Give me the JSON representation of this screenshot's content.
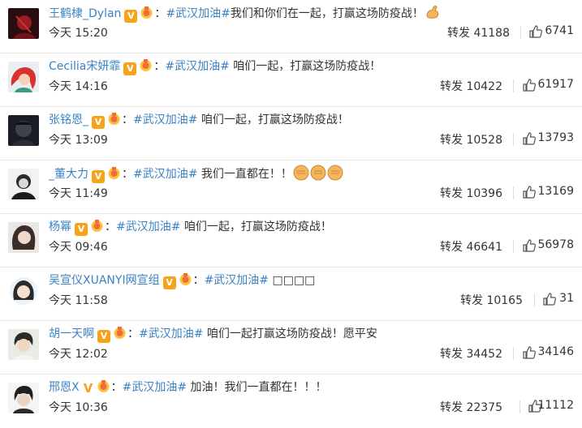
{
  "posts": [
    {
      "name": "王鹤棣_Dylan",
      "tag": "#武汉加油#",
      "text": "我们和你们在一起，打赢这场防疫战！",
      "time": "今天 15:20",
      "repost_label": "转发",
      "repost_count": "41188",
      "likes": "6741",
      "emoji": "flexed-arm-icon"
    },
    {
      "name": "Cecilia宋妍霏",
      "tag": "#武汉加油#",
      "text": " 咱们一起，打赢这场防疫战！",
      "time": "今天 14:16",
      "repost_label": "转发",
      "repost_count": "10422",
      "likes": "61917"
    },
    {
      "name": "张铭恩_",
      "tag": "#武汉加油#",
      "text": " 咱们一起，打赢这场防疫战！",
      "time": "今天 13:09",
      "repost_label": "转发",
      "repost_count": "10528",
      "likes": "13793"
    },
    {
      "name": "_董大力",
      "tag": "#武汉加油#",
      "text": " 我们一直都在！！",
      "time": "今天 11:49",
      "repost_label": "转发",
      "repost_count": "10396",
      "likes": "13169",
      "emoji": "fist-icon"
    },
    {
      "name": "杨幂",
      "tag": "#武汉加油#",
      "text": " 咱们一起，打赢这场防疫战！",
      "time": "今天 09:46",
      "repost_label": "转发",
      "repost_count": "46641",
      "likes": "56978"
    },
    {
      "name": "吴宣仪XUANYI网宣组",
      "tag": "#武汉加油#",
      "text": " □□□□",
      "time": "今天 11:58",
      "repost_label": "转发",
      "repost_count": "10165",
      "likes": "31"
    },
    {
      "name": "胡一天啊",
      "tag": "#武汉加油#",
      "text": " 咱们一起打赢这场防疫战！愿平安",
      "time": "今天 12:02",
      "repost_label": "转发",
      "repost_count": "34452",
      "likes": "34146"
    },
    {
      "name": "邢恩X",
      "tag": "#武汉加油#",
      "text": " 加油！我们一直都在！！！",
      "time": "今天 10:36",
      "repost_label": "转发",
      "repost_count": "22375",
      "likes": "11112"
    }
  ],
  "colon": "：",
  "colors": {
    "link": "#3a82c4",
    "badge": "#f7a21b",
    "text": "#333333",
    "divider": "#e6e6e6"
  },
  "icons": {
    "verified": "verified-v-icon",
    "fan": "fan-badge-icon",
    "like": "thumbs-up-icon"
  }
}
